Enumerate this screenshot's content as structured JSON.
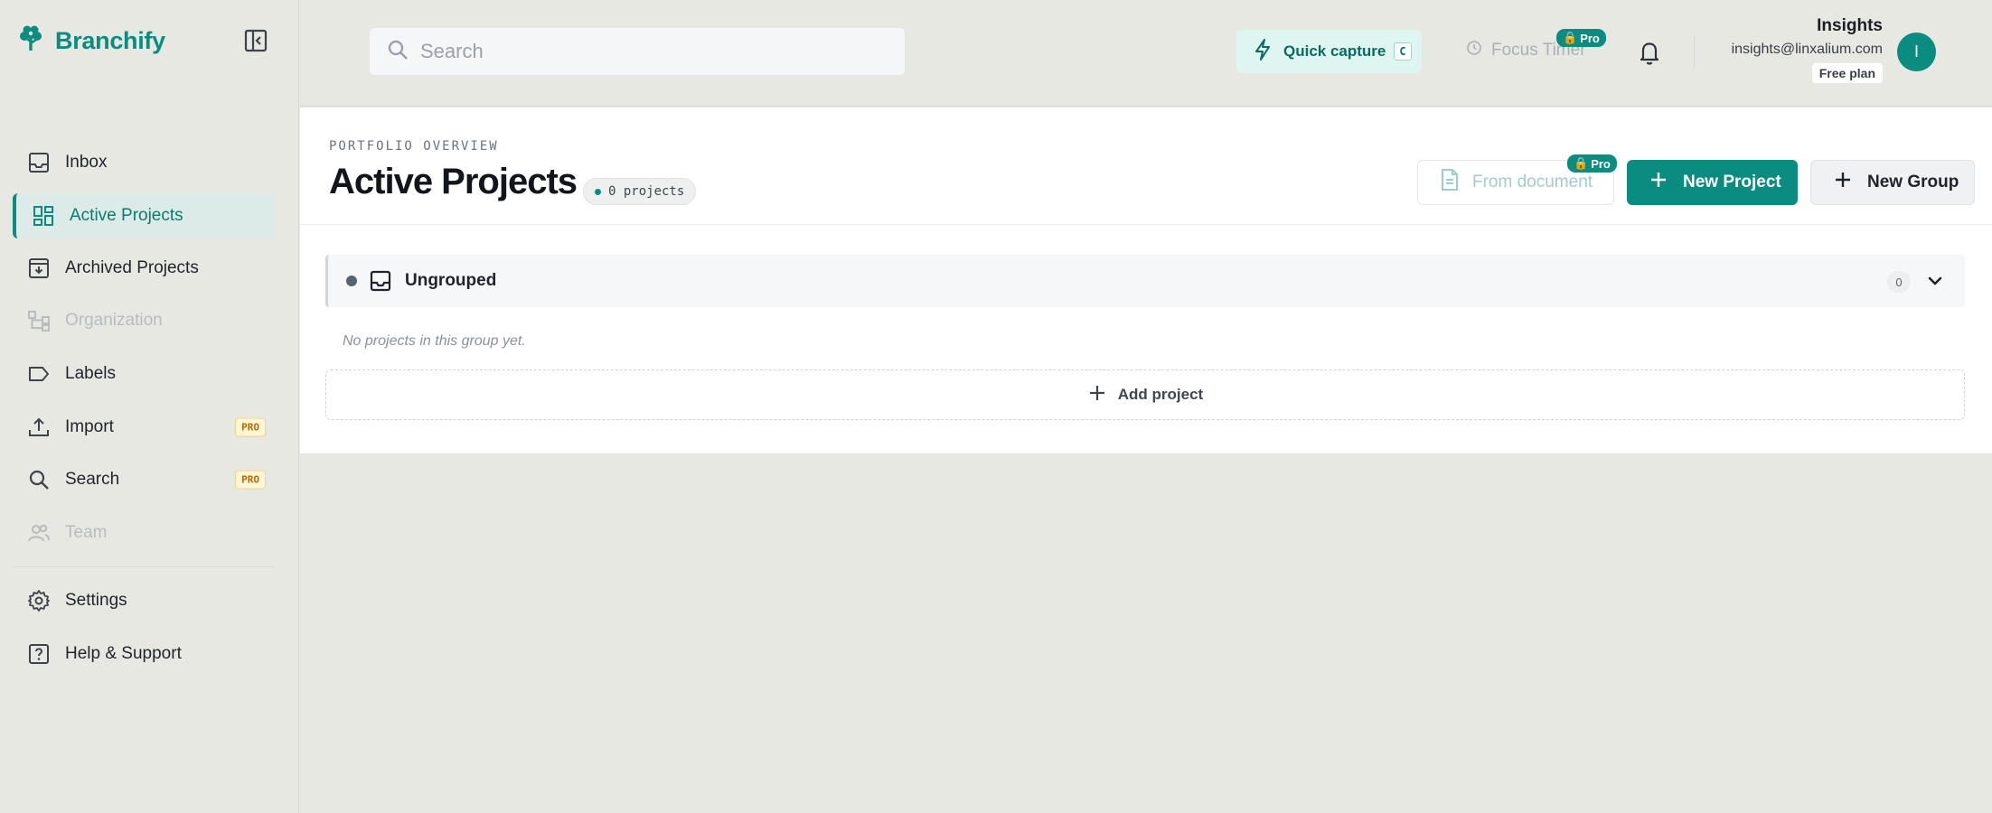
{
  "brand": {
    "name": "Branchify",
    "accent": "#0b8c80"
  },
  "sidebar": {
    "items": [
      {
        "label": "Inbox",
        "icon": "inbox-icon",
        "state": "normal"
      },
      {
        "label": "Active Projects",
        "icon": "grid-icon",
        "state": "active"
      },
      {
        "label": "Archived Projects",
        "icon": "archive-icon",
        "state": "normal"
      },
      {
        "label": "Organization",
        "icon": "org-chart-icon",
        "state": "disabled"
      },
      {
        "label": "Labels",
        "icon": "tag-icon",
        "state": "normal"
      },
      {
        "label": "Import",
        "icon": "upload-icon",
        "state": "normal",
        "badge": "PRO"
      },
      {
        "label": "Search",
        "icon": "search-icon",
        "state": "normal",
        "badge": "PRO"
      },
      {
        "label": "Team",
        "icon": "users-icon",
        "state": "disabled"
      }
    ],
    "bottom_items": [
      {
        "label": "Settings",
        "icon": "gear-icon"
      },
      {
        "label": "Help & Support",
        "icon": "help-icon"
      }
    ]
  },
  "topbar": {
    "search_placeholder": "Search",
    "quick_capture": {
      "label": "Quick capture",
      "shortcut": "C"
    },
    "focus_timer": {
      "label": "Focus Timer",
      "badge": "Pro"
    },
    "user": {
      "name": "Insights",
      "email": "insights@linxalium.com",
      "plan": "Free plan",
      "initial": "I"
    }
  },
  "main": {
    "eyebrow": "PORTFOLIO OVERVIEW",
    "title": "Active Projects",
    "count": "0 projects",
    "buttons": {
      "from_document": "From document",
      "from_document_badge": "Pro",
      "new_project": "New Project",
      "new_group": "New Group"
    },
    "group": {
      "name": "Ungrouped",
      "count": "0"
    },
    "empty_message": "No projects in this group yet.",
    "add_project": "Add project"
  }
}
